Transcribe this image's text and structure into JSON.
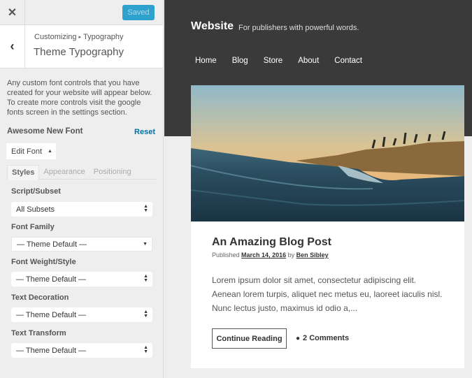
{
  "sidebar": {
    "close_icon": "✕",
    "saved_label": "Saved",
    "back_icon": "‹",
    "breadcrumb": {
      "parent": "Customizing",
      "separator": "▸",
      "current": "Typography"
    },
    "section_title": "Theme Typography",
    "description": "Any custom font controls that you have created for your website will appear below. To create more controls visit the google fonts screen in the settings section.",
    "font_name": "Awesome New Font",
    "reset_label": "Reset",
    "edit_font_label": "Edit Font",
    "edit_font_icon": "▲",
    "tabs": [
      {
        "label": "Styles",
        "active": true
      },
      {
        "label": "Appearance",
        "active": false
      },
      {
        "label": "Positioning",
        "active": false
      }
    ],
    "fields": [
      {
        "label": "Script/Subset",
        "value": "All Subsets"
      },
      {
        "label": "Font Family",
        "value": "— Theme Default —"
      },
      {
        "label": "Font Weight/Style",
        "value": "— Theme Default —"
      },
      {
        "label": "Text Decoration",
        "value": "— Theme Default —"
      },
      {
        "label": "Text Transform",
        "value": "— Theme Default —"
      }
    ]
  },
  "preview": {
    "site_title": "Website",
    "tagline": "For publishers with powerful words.",
    "nav": [
      "Home",
      "Blog",
      "Store",
      "About",
      "Contact"
    ],
    "post": {
      "title": "An Amazing Blog Post",
      "meta_prefix": "Published",
      "date": "March 14, 2016",
      "meta_by": "by",
      "author": "Ben Sibley",
      "excerpt": "Lorem ipsum dolor sit amet, consectetur adipiscing elit. Aenean lorem turpis, aliquet nec metus eu, laoreet iaculis nisl. Nunc lectus justo, maximus id odio a,...",
      "continue_label": "Continue Reading",
      "comments_icon": "💬",
      "comments_label": "2 Comments"
    }
  },
  "colors": {
    "accent": "#2ea2cc",
    "link": "#0073aa",
    "header_bg": "#3a3a3a"
  }
}
